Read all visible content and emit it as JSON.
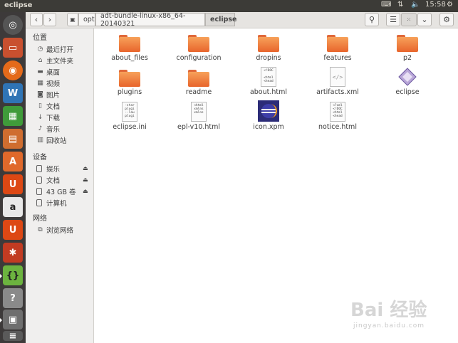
{
  "window": {
    "title": "eclipse"
  },
  "indicators": {
    "time": "15:58"
  },
  "breadcrumb": {
    "items": [
      "opt",
      "adt-bundle-linux-x86_64-20140321",
      "eclipse"
    ]
  },
  "sidebar": {
    "places_header": "位置",
    "places": [
      "最近打开",
      "主文件夹",
      "桌面",
      "视频",
      "图片",
      "文档",
      "下载",
      "音乐",
      "回收站"
    ],
    "devices_header": "设备",
    "devices": [
      "娱乐",
      "文档",
      "43 GB 卷",
      "计算机"
    ],
    "network_header": "网络",
    "network": [
      "浏览网络"
    ]
  },
  "files": [
    {
      "name": "about_files",
      "type": "folder"
    },
    {
      "name": "configuration",
      "type": "folder"
    },
    {
      "name": "dropins",
      "type": "folder"
    },
    {
      "name": "features",
      "type": "folder"
    },
    {
      "name": "p2",
      "type": "folder"
    },
    {
      "name": "plugins",
      "type": "folder"
    },
    {
      "name": "readme",
      "type": "folder"
    },
    {
      "name": "about.html",
      "type": "html"
    },
    {
      "name": "artifacts.xml",
      "type": "xml"
    },
    {
      "name": "eclipse",
      "type": "executable"
    },
    {
      "name": "eclipse.ini",
      "type": "text"
    },
    {
      "name": "epl-v10.html",
      "type": "html"
    },
    {
      "name": "icon.xpm",
      "type": "image"
    },
    {
      "name": "notice.html",
      "type": "html"
    }
  ],
  "watermark": {
    "brand": "Bai 经验",
    "url": "jingyan.baidu.com"
  },
  "colors": {
    "panel": "#3c3b37",
    "launcher": "#3d3a3a",
    "folder": "#f0853f"
  }
}
